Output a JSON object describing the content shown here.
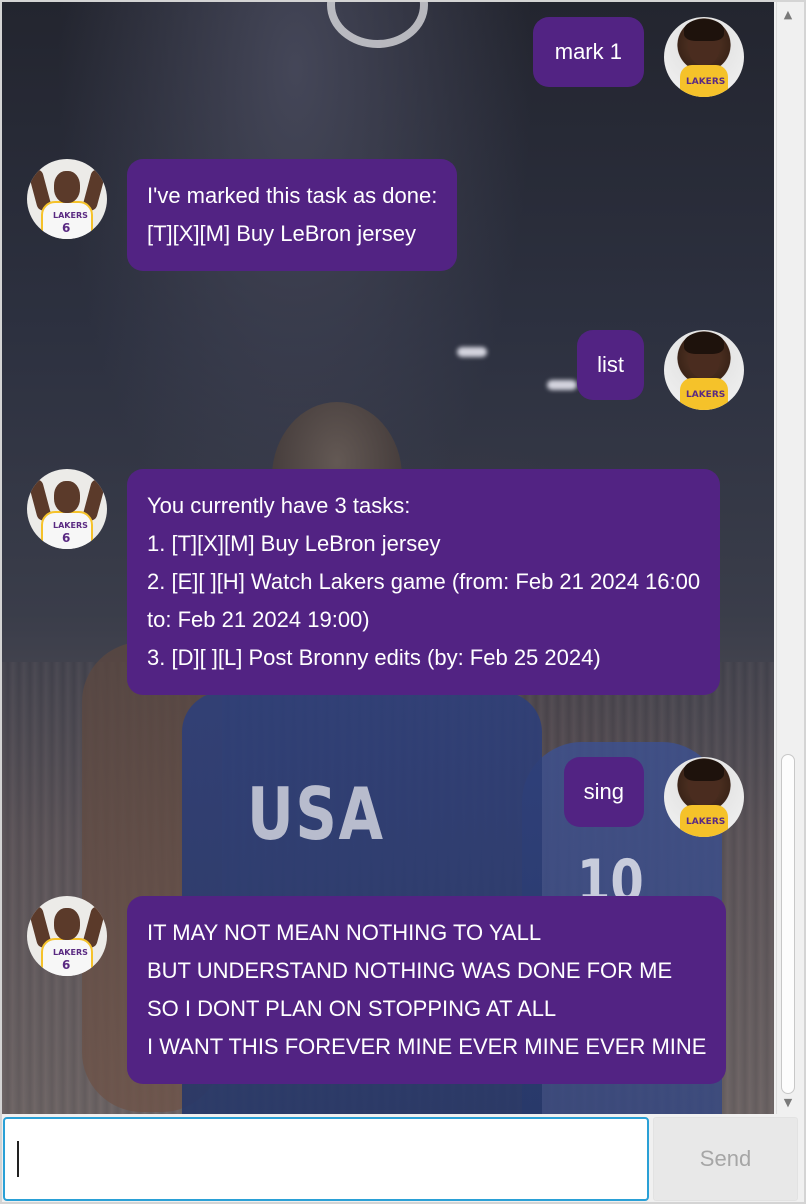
{
  "messages": [
    {
      "sender": "user",
      "lines": [
        "mark 1"
      ]
    },
    {
      "sender": "bot",
      "lines": [
        "I've marked this task as done:",
        "[T][X][M] Buy LeBron jersey"
      ]
    },
    {
      "sender": "user",
      "lines": [
        "list"
      ]
    },
    {
      "sender": "bot",
      "lines": [
        "You currently have 3 tasks:",
        "1. [T][X][M] Buy LeBron jersey",
        "2. [E][ ][H] Watch Lakers game (from: Feb 21 2024 16:00",
        "to: Feb 21 2024 19:00)",
        "3. [D][ ][L] Post Bronny edits (by: Feb 25 2024)"
      ]
    },
    {
      "sender": "user",
      "lines": [
        "sing"
      ]
    },
    {
      "sender": "bot",
      "lines": [
        "IT MAY NOT MEAN NOTHING TO YALL",
        "BUT UNDERSTAND NOTHING WAS DONE FOR ME",
        "SO I DONT PLAN ON STOPPING AT ALL",
        "I WANT THIS FOREVER MINE EVER MINE EVER MINE"
      ]
    }
  ],
  "avatars": {
    "user": {
      "text": "LAKERS"
    },
    "bot": {
      "text": "LAKERS",
      "number": "6"
    }
  },
  "background": {
    "jersey_text": "USA",
    "jersey_number": "10"
  },
  "input": {
    "value": "",
    "placeholder": ""
  },
  "send_button": {
    "label": "Send"
  },
  "colors": {
    "bubble": "#522383",
    "input_border": "#2aa0d6"
  }
}
